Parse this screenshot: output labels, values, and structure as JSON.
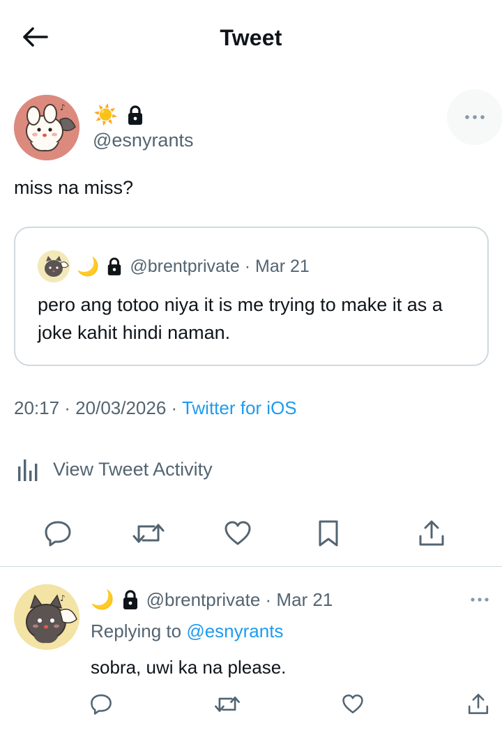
{
  "header": {
    "title": "Tweet",
    "back_icon": "arrow-left-icon"
  },
  "tweet": {
    "name_emoji": "☀️",
    "handle": "@esnyrants",
    "text": "miss na miss?",
    "timestamp": "20:17 · 20/03/2026 · ",
    "source": "Twitter for iOS",
    "activity_label": "View Tweet Activity"
  },
  "quote": {
    "name_emoji": "🌙",
    "handle_date": "@brentprivate · Mar 21",
    "text": "pero ang totoo niya it is me trying to make it as a joke kahit hindi naman."
  },
  "reply": {
    "name_emoji": "🌙",
    "handle_date": "@brentprivate · Mar 21",
    "replying_prefix": "Replying to",
    "replying_to": "@esnyrants",
    "text": "sobra, uwi ka na please."
  },
  "colors": {
    "accent": "#1d9bf0",
    "muted": "#536471",
    "text": "#0f1419",
    "border": "#cfd9de"
  }
}
